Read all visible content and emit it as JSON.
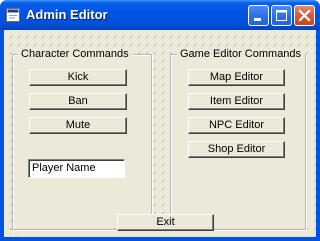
{
  "window": {
    "title": "Admin Editor"
  },
  "title_buttons": {
    "minimize": "minimize",
    "maximize": "maximize",
    "close": "close"
  },
  "character_commands": {
    "caption": "Character Commands",
    "buttons": [
      "Kick",
      "Ban",
      "Mute"
    ],
    "player_name_value": "Player Name"
  },
  "game_editor_commands": {
    "caption": "Game Editor Commands",
    "buttons": [
      "Map Editor",
      "Item Editor",
      "NPC Editor",
      "Shop Editor"
    ]
  },
  "exit_label": "Exit",
  "colors": {
    "titlebar": "#0054e3",
    "close_button": "#d45c3a",
    "face": "#ece9d8"
  }
}
